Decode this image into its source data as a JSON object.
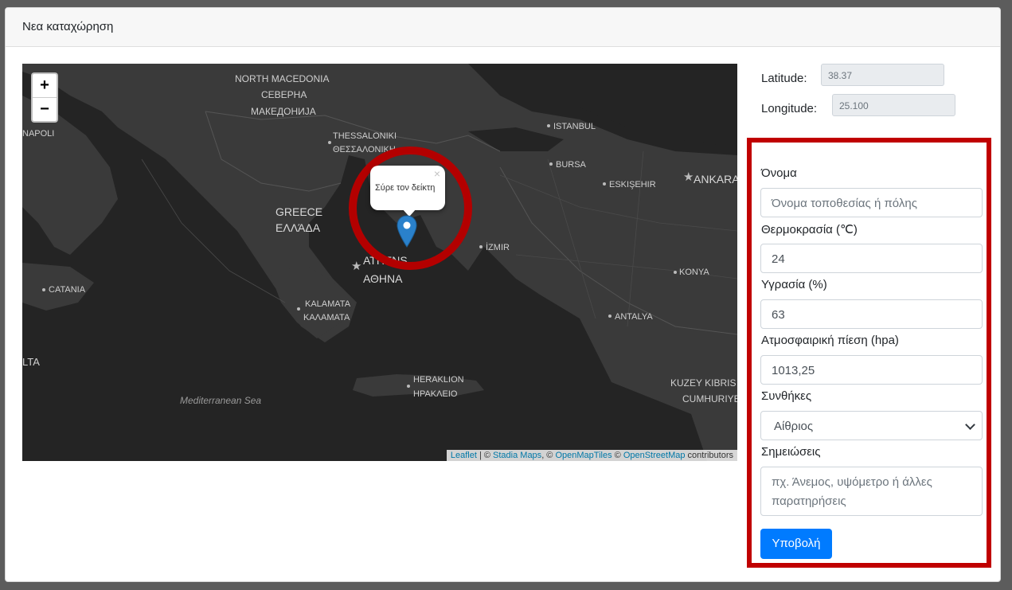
{
  "header": {
    "title": "Νεα καταχώρηση"
  },
  "map": {
    "zoom_in": "+",
    "zoom_out": "−",
    "labels": {
      "north_macedonia": "NORTH MACEDONIA",
      "severna": "СЕВЕРНА",
      "makedonija": "МАКЕДОНИЈА",
      "thessaloniki": "THESSALONIKI",
      "thessaloniki_gr": "ΘΕΣΣΑΛΟΝΙΚΗ",
      "istanbul": "ISTANBUL",
      "bursa": "BURSA",
      "eskisehir": "ESKIŞEHIR",
      "ankara": "ANKARA",
      "greece": "GREECE",
      "greece_gr": "ΕΛΛΆΔΑ",
      "athens": "ATHENS",
      "athens_gr": "ΑΘΗΝΑ",
      "izmir": "İZMIR",
      "konya": "KONYA",
      "catania": "CATANIA",
      "napoli": "NAPOLI",
      "kalamata": "KALAMATA",
      "kalamata_gr": "ΚΑΛΑΜΑΤΑ",
      "antalya": "ANTALYA",
      "malta": "LTA",
      "heraklion": "HERAKLION",
      "heraklion_gr": "ΗΡΑΚΛΕΙΟ",
      "kuzey_kibris": "KUZEY KIBRIS",
      "cumhuriyeti": "CUMHURIYE",
      "sea": "Mediterranean Sea"
    },
    "popup_text": "Σύρε τον δείκτη",
    "popup_close": "×",
    "attribution": {
      "leaflet": "Leaflet",
      "sep1": " | © ",
      "stadia": "Stadia Maps",
      "sep2": ", © ",
      "openmaptiles": "OpenMapTiles",
      "sep3": " © ",
      "osm": "OpenStreetMap",
      "tail": " contributors"
    }
  },
  "coords": {
    "lat_label": "Latitude:",
    "lat_value": "38.37",
    "lon_label": "Longitude:",
    "lon_value": "25.100"
  },
  "form": {
    "name_label": "Όνομα",
    "name_placeholder": "Όνομα τοποθεσίας ή πόλης",
    "temp_label": "Θερμοκρασία (℃)",
    "temp_value": "24",
    "humidity_label": "Υγρασία (%)",
    "humidity_value": "63",
    "pressure_label": "Ατμοσφαιρική πίεση (hpa)",
    "pressure_value": "1013,25",
    "conditions_label": "Συνθήκες",
    "conditions_value": "Αίθριος",
    "notes_label": "Σημειώσεις",
    "notes_placeholder": "πχ. Άνεμος, υψόμετρο ή άλλες παρατηρήσεις",
    "submit_label": "Υποβολή"
  },
  "colors": {
    "highlight": "#c00000",
    "primary": "#007bff",
    "map_land": "#3a3a3a",
    "map_sea": "#242424"
  }
}
